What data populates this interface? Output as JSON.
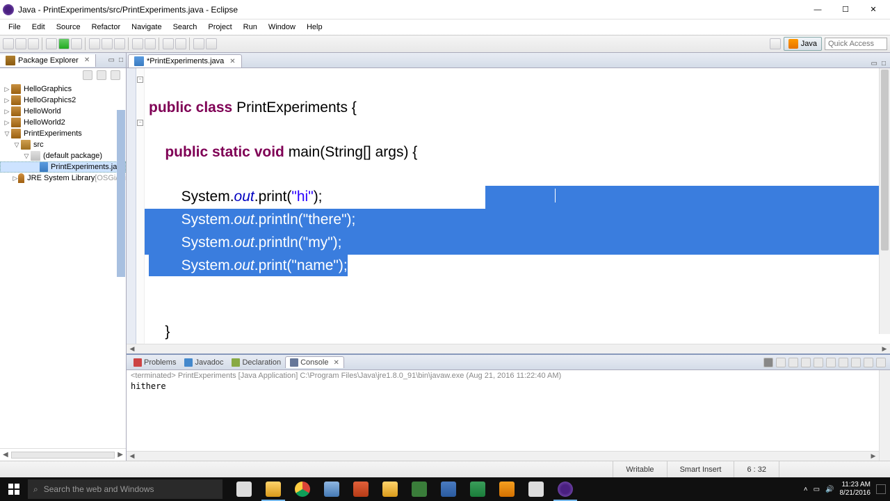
{
  "window": {
    "title": "Java - PrintExperiments/src/PrintExperiments.java - Eclipse"
  },
  "menus": [
    "File",
    "Edit",
    "Source",
    "Refactor",
    "Navigate",
    "Search",
    "Project",
    "Run",
    "Window",
    "Help"
  ],
  "perspective": {
    "label": "Java"
  },
  "quick_access": {
    "placeholder": "Quick Access"
  },
  "package_explorer": {
    "title": "Package Explorer",
    "projects": [
      {
        "name": "HelloGraphics",
        "expanded": false
      },
      {
        "name": "HelloGraphics2",
        "expanded": false
      },
      {
        "name": "HelloWorld",
        "expanded": false
      },
      {
        "name": "HelloWorld2",
        "expanded": false
      },
      {
        "name": "PrintExperiments",
        "expanded": true,
        "children": [
          {
            "name": "src",
            "type": "srcfolder",
            "expanded": true,
            "children": [
              {
                "name": "(default package)",
                "type": "package",
                "expanded": true,
                "children": [
                  {
                    "name": "PrintExperiments.java",
                    "type": "javafile",
                    "selected": true
                  }
                ]
              }
            ]
          },
          {
            "name": "JRE System Library",
            "suffix": " [OSGi/Mi",
            "type": "jre",
            "expanded": false
          }
        ]
      }
    ]
  },
  "editor": {
    "tab_title": "*PrintExperiments.java",
    "code": {
      "class_decl_pre": "public class ",
      "class_name": "PrintExperiments",
      "class_decl_post": " {",
      "method_sig_pre": "    public static void ",
      "method_name": "main",
      "method_sig_post": "(String[] args) {",
      "l1_a": "        System.",
      "l1_b": "out",
      "l1_c": ".print(",
      "l1_d": "\"hi\"",
      "l1_e": ");",
      "l2_a": "        System.",
      "l2_b": "out",
      "l2_c": ".println(",
      "l2_d": "\"there\"",
      "l2_e": ");",
      "l3_a": "        System.",
      "l3_b": "out",
      "l3_c": ".println(",
      "l3_d": "\"my\"",
      "l3_e": ");",
      "l4_a": "        System.",
      "l4_b": "out",
      "l4_c": ".print(",
      "l4_d": "\"name\"",
      "l4_e": ");",
      "close_brace": "    }"
    }
  },
  "bottom": {
    "tabs": [
      "Problems",
      "Javadoc",
      "Declaration",
      "Console"
    ],
    "active": 3,
    "console_header_prefix": "<terminated> ",
    "console_header": "PrintExperiments [Java Application] C:\\Program Files\\Java\\jre1.8.0_91\\bin\\javaw.exe (Aug 21, 2016 11:22:40 AM)",
    "console_output": "hithere"
  },
  "status": {
    "writable": "Writable",
    "insert": "Smart Insert",
    "pos": "6 : 32"
  },
  "taskbar": {
    "search_placeholder": "Search the web and Windows",
    "clock_time": "11:23 AM",
    "clock_date": "8/21/2016"
  }
}
